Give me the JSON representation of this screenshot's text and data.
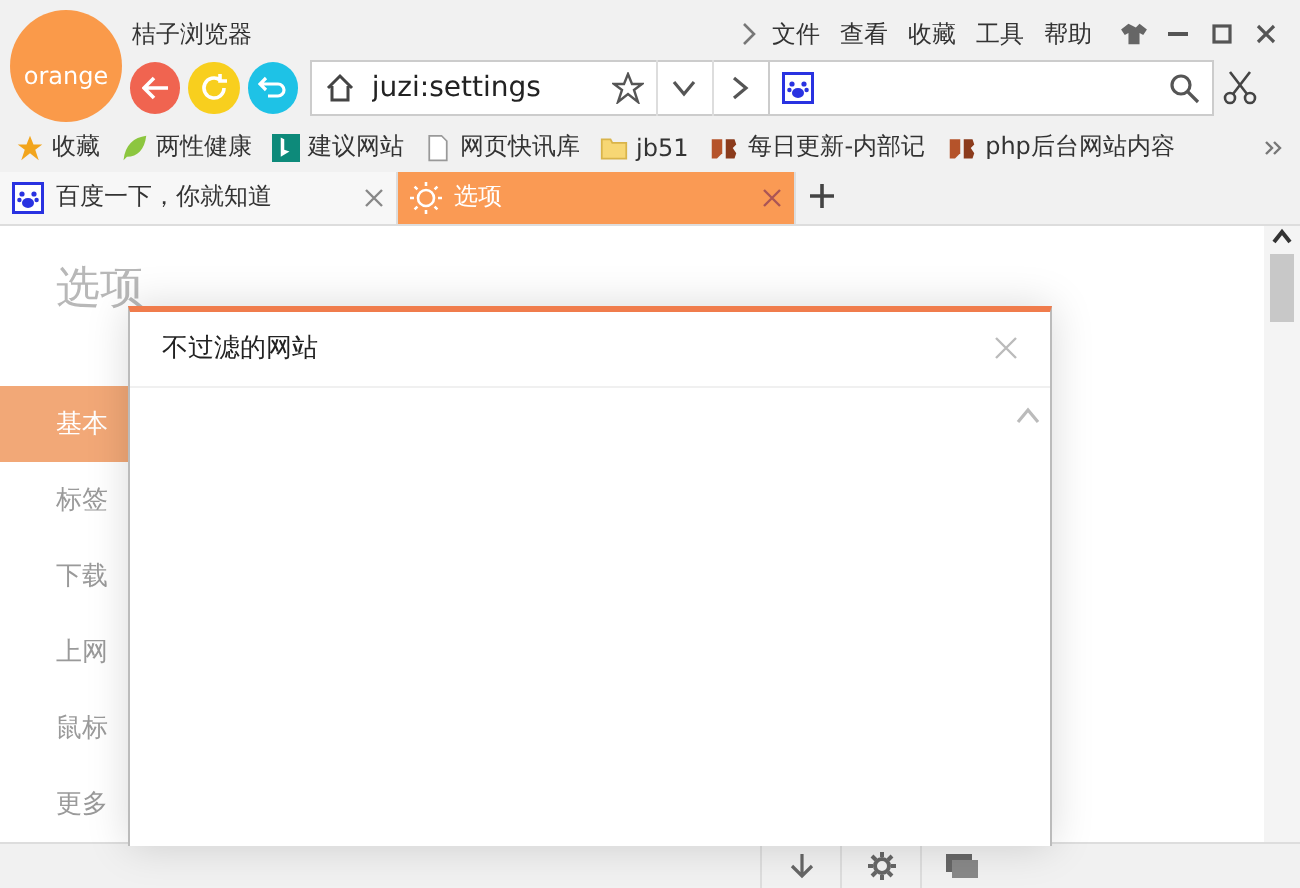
{
  "browser": {
    "logo_text": "orange",
    "title": "桔子浏览器",
    "menu": [
      "文件",
      "查看",
      "收藏",
      "工具",
      "帮助"
    ]
  },
  "address_bar": {
    "url": "juzi:settings"
  },
  "bookmarks": [
    {
      "label": "收藏"
    },
    {
      "label": "两性健康"
    },
    {
      "label": "建议网站"
    },
    {
      "label": "网页快讯库"
    },
    {
      "label": "jb51"
    },
    {
      "label": "每日更新-内部记"
    },
    {
      "label": "php后台网站内容"
    }
  ],
  "tabs": [
    {
      "label": "百度一下，你就知道",
      "selected": false
    },
    {
      "label": "选项",
      "selected": true
    }
  ],
  "page": {
    "title": "选项",
    "sidebar": [
      {
        "label": "基本",
        "selected": true
      },
      {
        "label": "标签",
        "selected": false
      },
      {
        "label": "下载",
        "selected": false
      },
      {
        "label": "上网",
        "selected": false
      },
      {
        "label": "鼠标",
        "selected": false
      },
      {
        "label": "更多",
        "selected": false
      }
    ]
  },
  "dialog": {
    "title": "不过滤的网站"
  }
}
